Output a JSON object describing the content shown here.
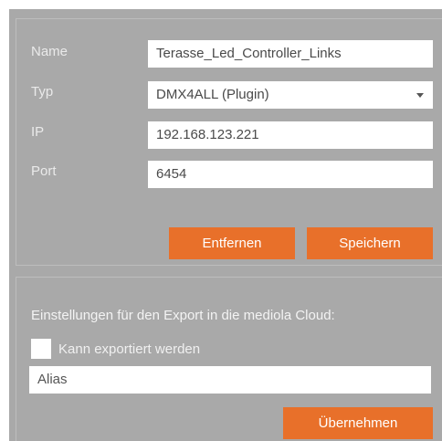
{
  "device_form": {
    "name": {
      "label": "Name",
      "value": "Terasse_Led_Controller_Links"
    },
    "type": {
      "label": "Typ",
      "value": "DMX4ALL (Plugin)"
    },
    "ip": {
      "label": "IP",
      "value": "192.168.123.221"
    },
    "port": {
      "label": "Port",
      "value": "6454"
    },
    "remove_button": "Entfernen",
    "save_button": "Speichern"
  },
  "export_section": {
    "title": "Einstellungen für den Export in die mediola Cloud:",
    "checkbox_label": "Kann exportiert werden",
    "checkbox_checked": false,
    "alias_placeholder": "Alias",
    "apply_button": "Übernehmen"
  },
  "colors": {
    "panel_background": "#a9a9a9",
    "accent_button": "#e8702a"
  }
}
